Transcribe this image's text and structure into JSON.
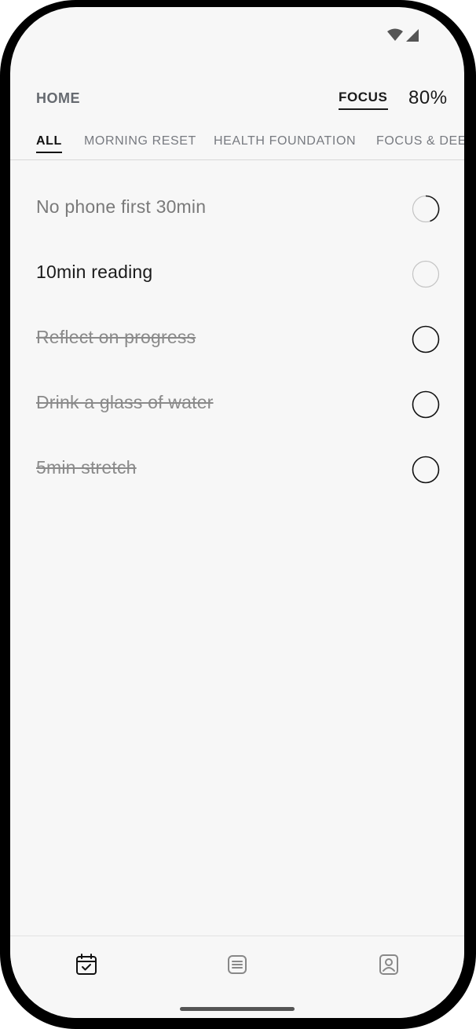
{
  "status_bar": {
    "wifi_icon": "wifi-icon",
    "signal_icon": "signal-icon"
  },
  "header": {
    "title": "HOME",
    "focus_label": "FOCUS",
    "focus_value": "80%"
  },
  "categories": [
    {
      "label": "ALL",
      "active": true
    },
    {
      "label": "MORNING RESET",
      "active": false
    },
    {
      "label": "HEALTH FOUNDATION",
      "active": false
    },
    {
      "label": "FOCUS & DEEP",
      "active": false
    }
  ],
  "tasks": [
    {
      "label": "No phone first 30min",
      "state": "in-progress",
      "progress": 0.35
    },
    {
      "label": "10min reading",
      "state": "pending",
      "progress": 0
    },
    {
      "label": "Reflect on progress",
      "state": "done",
      "progress": 1
    },
    {
      "label": "Drink a glass of water",
      "state": "done",
      "progress": 1
    },
    {
      "label": "5min stretch",
      "state": "done",
      "progress": 1
    }
  ],
  "bottom_nav": [
    {
      "icon": "calendar-check-icon",
      "active": true
    },
    {
      "icon": "list-icon",
      "active": false
    },
    {
      "icon": "profile-icon",
      "active": false
    }
  ],
  "colors": {
    "accent": "#1a1a1a",
    "muted": "#777a80",
    "background": "#f7f7f7"
  }
}
